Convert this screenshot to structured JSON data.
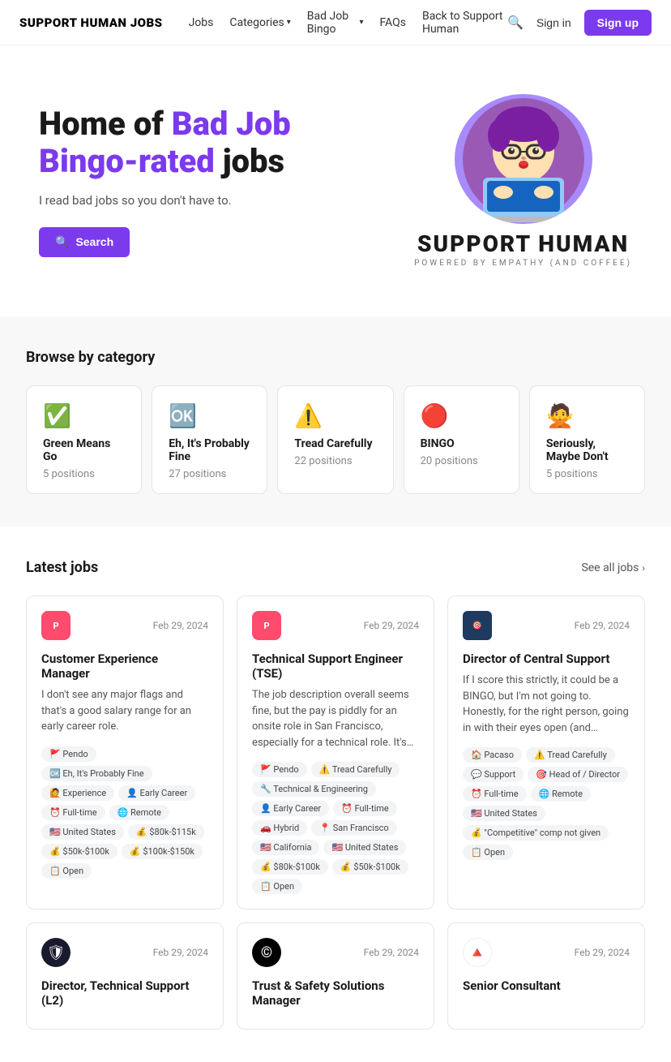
{
  "nav": {
    "logo": "SUPPORT HUMAN JOBS",
    "links": [
      {
        "label": "Jobs",
        "hasDropdown": false
      },
      {
        "label": "Categories",
        "hasDropdown": true
      },
      {
        "label": "Bad Job Bingo",
        "hasDropdown": true
      },
      {
        "label": "FAQs",
        "hasDropdown": false
      },
      {
        "label": "Back to Support Human",
        "hasDropdown": false
      }
    ],
    "signin_label": "Sign in",
    "signup_label": "Sign up"
  },
  "hero": {
    "title_part1": "Home of ",
    "title_accent": "Bad Job Bingo-rated",
    "title_part2": " jobs",
    "subtitle": "I read bad jobs so you don't have to.",
    "search_label": "Search",
    "brand_name": "SUPPORT HUMAN",
    "brand_sub": "POWERED BY EMPATHY (AND COFFEE)"
  },
  "categories": {
    "section_title": "Browse by category",
    "items": [
      {
        "emoji": "✅",
        "name": "Green Means Go",
        "count": "5 positions"
      },
      {
        "emoji": "🆗",
        "name": "Eh, It's Probably Fine",
        "count": "27 positions"
      },
      {
        "emoji": "⚠️",
        "name": "Tread Carefully",
        "count": "22 positions"
      },
      {
        "emoji": "🔴",
        "name": "BINGO",
        "count": "20 positions"
      },
      {
        "emoji": "🙅",
        "name": "Seriously, Maybe Don't",
        "count": "5 positions"
      }
    ]
  },
  "latest_jobs": {
    "section_title": "Latest jobs",
    "see_all_label": "See all jobs",
    "jobs": [
      {
        "logo_text": "P",
        "logo_class": "logo-pendo",
        "logo_emoji": "",
        "date": "Feb 29, 2024",
        "title": "Customer Experience Manager",
        "desc": "I don't see any major flags and that's a good salary range for an early career role.",
        "tags": [
          "🚩 Pendo",
          "🆗 Eh, It's Probably Fine",
          "🙋 Experience",
          "👤 Early Career",
          "⏰ Full-time",
          "🌐 Remote",
          "🇺🇸 United States",
          "💰 $80k-$115k",
          "💰 $50k-$100k",
          "💰 $100k-$150k",
          "📋 Open"
        ]
      },
      {
        "logo_text": "P",
        "logo_class": "logo-pendo",
        "logo_emoji": "",
        "date": "Feb 29, 2024",
        "title": "Technical Support Engineer (TSE)",
        "desc": "The job description overall seems fine, but the pay is piddly for an onsite role in San Francisco, especially for a technical role. It's low enough, in fact, that I'm putting it in Tread Carefully.",
        "tags": [
          "🚩 Pendo",
          "⚠️ Tread Carefully",
          "🔧 Technical & Engineering",
          "👤 Early Career",
          "⏰ Full-time",
          "🚗 Hybrid",
          "📍 San Francisco",
          "🇺🇸 California",
          "🇺🇸 United States",
          "💰 $80k-$100k",
          "💰 $50k-$100k",
          "📋 Open"
        ]
      },
      {
        "logo_text": "🎯",
        "logo_class": "logo-pacaso",
        "logo_emoji": "🎯",
        "date": "Feb 29, 2024",
        "title": "Director of Central Support",
        "desc": "If I score this strictly, it could be a BINGO, but I'm not going to. Honestly, for the right person, going in with their eyes open (and assuming the pay doesn't suck)? It could be an interesting, meaty role.",
        "tags": [
          "🏠 Pacaso",
          "⚠️ Tread Carefully",
          "💬 Support",
          "🎯 Head of / Director",
          "⏰ Full-time",
          "🌐 Remote",
          "🇺🇸 United States",
          "💰 \"Competitive\" comp not given",
          "📋 Open"
        ]
      },
      {
        "logo_text": "🛡",
        "logo_class": "logo-shield",
        "logo_emoji": "🛡",
        "date": "Feb 29, 2024",
        "title": "Director, Technical Support (L2)",
        "desc": "",
        "tags": []
      },
      {
        "logo_text": "C",
        "logo_class": "logo-ccc",
        "logo_emoji": "©",
        "date": "Feb 29, 2024",
        "title": "Trust & Safety Solutions Manager",
        "desc": "",
        "tags": []
      },
      {
        "logo_text": "T",
        "logo_class": "logo-trilogy",
        "logo_emoji": "🔺",
        "date": "Feb 29, 2024",
        "title": "Senior Consultant",
        "desc": "",
        "tags": []
      }
    ]
  }
}
